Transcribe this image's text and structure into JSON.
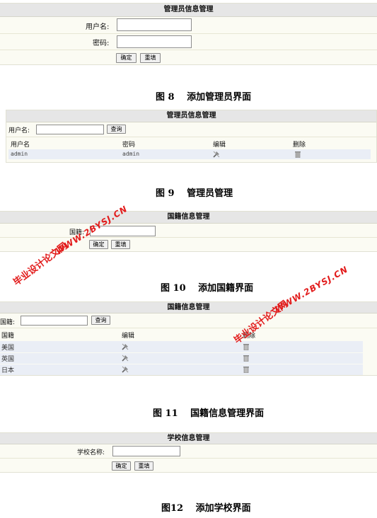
{
  "fig8": {
    "header": "管理员信息管理",
    "username_label": "用户名:",
    "password_label": "密码:",
    "confirm": "确定",
    "reset": "重填",
    "caption": "图 8　 添加管理员界面"
  },
  "fig9": {
    "header": "管理员信息管理",
    "search_label": "用户名:",
    "search_button": "查询",
    "columns": [
      "用户名",
      "密码",
      "编辑",
      "删除"
    ],
    "rows": [
      {
        "username": "admin",
        "password": "admin"
      }
    ],
    "caption": "图 9　 管理员管理"
  },
  "fig10": {
    "header": "国籍信息管理",
    "field_label": "国籍:",
    "confirm": "确定",
    "reset": "重填",
    "caption": "图 10　 添加国籍界面"
  },
  "fig11": {
    "header": "国籍信息管理",
    "search_label": "国籍:",
    "search_button": "查询",
    "columns": [
      "国籍",
      "编辑",
      "删除"
    ],
    "rows": [
      "美国",
      "英国",
      "日本"
    ],
    "caption": "图 11　 国籍信息管理界面"
  },
  "fig12": {
    "header": "学校信息管理",
    "field_label": "学校名称:",
    "confirm": "确定",
    "reset": "重填",
    "caption": "图12　 添加学校界面"
  },
  "watermark": {
    "cn": "毕业设计论文网",
    "url": "WWW.2BYSJ.CN",
    "color": "#e21b1b"
  },
  "icons": {
    "edit": "edit-tools-icon",
    "delete": "trash-icon"
  }
}
